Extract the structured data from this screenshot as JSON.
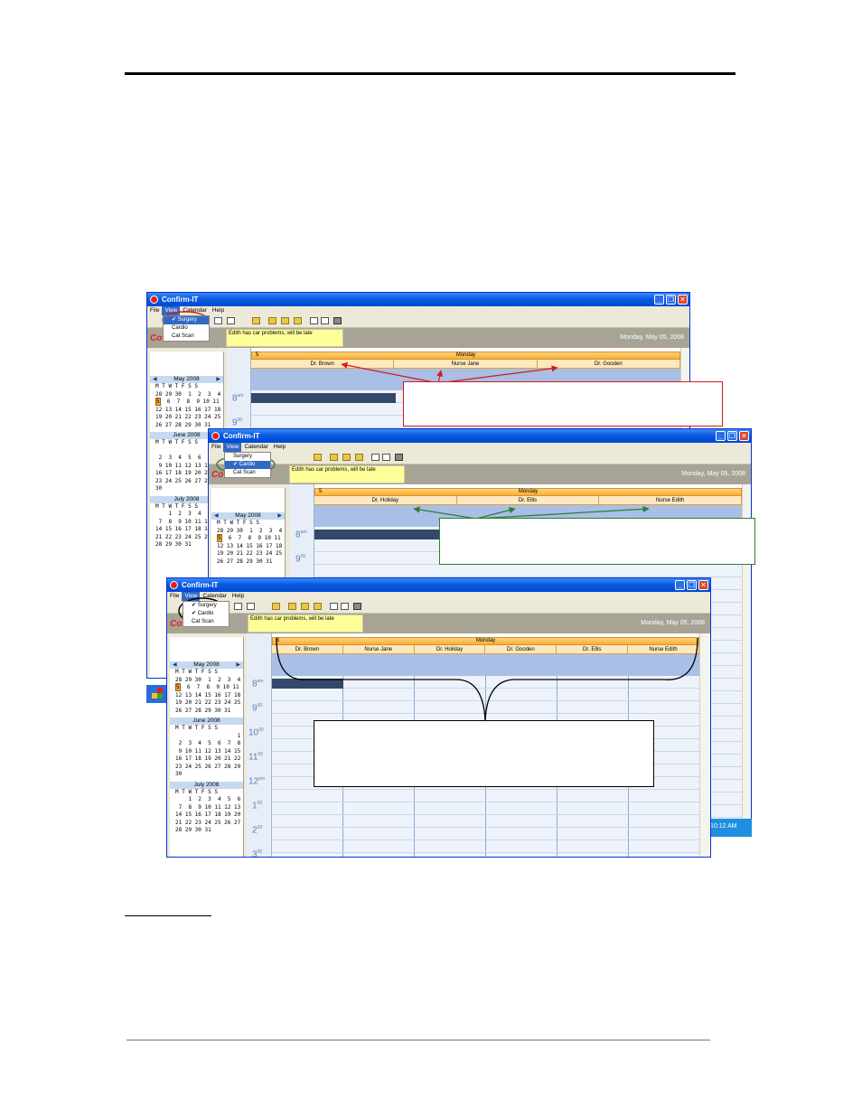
{
  "colors": {
    "accent": "#0a5ae0",
    "appointment": "#34496a",
    "callout_red": "#d41c1c",
    "callout_green": "#2e7d32"
  },
  "app": {
    "title": "Confirm-IT",
    "logo": "Co",
    "menu": [
      "File",
      "View",
      "Calendar",
      "Help"
    ],
    "view_menu": [
      "Surgery",
      "Cardio",
      "Cat Scan"
    ],
    "note": "Edith has car problems, will be late",
    "date": "Monday, May 05, 2008",
    "day_label": "Monday",
    "day_num": "5"
  },
  "window1": {
    "resources": [
      "Dr. Brown",
      "Nurse Jane",
      "Dr. Gooden"
    ]
  },
  "window2": {
    "resources": [
      "Dr. Holiday",
      "Dr. Ellis",
      "Nurse Edith"
    ]
  },
  "window3": {
    "resources": [
      "Dr. Brown",
      "Nurse Jane",
      "Dr. Holiday",
      "Dr. Gooden",
      "Dr. Ellis",
      "Nurse Edith"
    ]
  },
  "mini_cal": {
    "may": {
      "title": "May 2008",
      "dow": "M T W T F S S",
      "weeks": [
        "28 29 30  1  2  3  4",
        " 5  6  7  8  9 10 11",
        "12 13 14 15 16 17 18",
        "19 20 21 22 23 24 25",
        "26 27 28 29 30 31"
      ]
    },
    "june": {
      "title": "June 2008",
      "dow": "M T W T F S S",
      "weeks": [
        "                   1",
        " 2  3  4  5  6  7  8",
        " 9 10 11 12 13 14 15",
        "16 17 18 19 20 21 22",
        "23 24 25 26 27 28 29",
        "30"
      ]
    },
    "july": {
      "title": "July 2008",
      "dow": "M T W T F S S",
      "weeks": [
        "    1  2  3  4  5  6",
        " 7  8  9 10 11 12 13",
        "14 15 16 17 18 19 20",
        "21 22 23 24 25 26 27",
        "28 29 30 31"
      ]
    }
  },
  "hours": [
    {
      "h": "8",
      "s": "am"
    },
    {
      "h": "9",
      "s": "00"
    },
    {
      "h": "10",
      "s": "00"
    },
    {
      "h": "11",
      "s": "00"
    },
    {
      "h": "12",
      "s": "pm"
    },
    {
      "h": "1",
      "s": "00"
    },
    {
      "h": "2",
      "s": "00"
    },
    {
      "h": "3",
      "s": "00"
    }
  ],
  "taskbar": {
    "clock": "10:12 AM"
  }
}
